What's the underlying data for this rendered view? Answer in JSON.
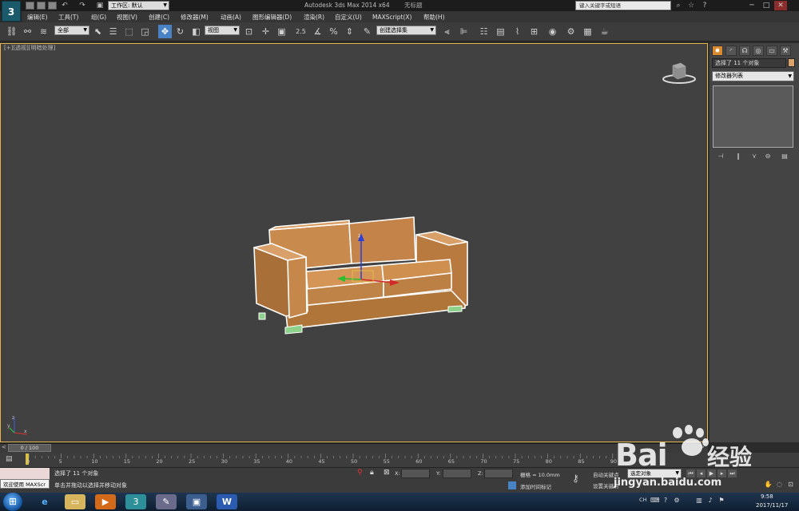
{
  "title_bar": {
    "workspace_label": "工作区: 默认",
    "app_title": "Autodesk 3ds Max  2014 x64",
    "document_title": "无标题",
    "help_search_placeholder": "键入关键字或短语"
  },
  "menu": {
    "items": [
      "编辑(E)",
      "工具(T)",
      "组(G)",
      "视图(V)",
      "创建(C)",
      "修改器(M)",
      "动画(A)",
      "图形编辑器(D)",
      "渲染(R)",
      "自定义(U)",
      "MAXScript(X)",
      "帮助(H)"
    ]
  },
  "toolbar": {
    "selection_filter": "全部",
    "reference_coord": "视图",
    "snap_value": "2.5",
    "named_selection": "创建选择集"
  },
  "viewport": {
    "label": "[+][透视][明暗处理]",
    "axis_x": "x",
    "axis_y": "y",
    "axis_z": "z"
  },
  "command_panel": {
    "object_name": "选择了 11 个对象",
    "modifier_list": "修改器列表",
    "object_color": "#d9a36a"
  },
  "timeline": {
    "frame_display": "0 / 100",
    "ticks": [
      "0",
      "5",
      "10",
      "15",
      "20",
      "25",
      "30",
      "35",
      "40",
      "45",
      "50",
      "55",
      "60",
      "65",
      "70",
      "75",
      "80",
      "85",
      "90"
    ]
  },
  "status": {
    "maxscript_label": "欢迎使用 MAXScr",
    "selection_text": "选择了 11 个对象",
    "prompt_text": "单击并拖动以选择并移动对象",
    "x_label": "X:",
    "y_label": "Y:",
    "z_label": "Z:",
    "grid_text": "栅格 = 10.0mm",
    "add_time_tag": "添加时间标记",
    "auto_key": "自动关键点",
    "set_key": "设置关键点",
    "selected_object": "选定对象"
  },
  "taskbar": {
    "lang": "CH",
    "time": "9:58",
    "date": "2017/11/17"
  },
  "watermark": {
    "brand": "Bai",
    "brand_cn": "经验",
    "url": "jingyan.baidu.com"
  },
  "colors": {
    "accent_active": "#4a83c5",
    "viewport_border": "#e3b54a",
    "sofa": "#c98a4e"
  }
}
